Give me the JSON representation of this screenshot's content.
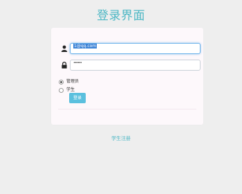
{
  "page": {
    "title": "登录界面"
  },
  "form": {
    "username": {
      "value": "1@qq.com",
      "icon": "user-icon"
    },
    "password": {
      "value": "••••••",
      "icon": "lock-icon"
    },
    "roles": [
      {
        "label": "管理员",
        "checked": true
      },
      {
        "label": "学生",
        "checked": false
      }
    ],
    "login_label": "登录"
  },
  "footer": {
    "register_label": "学生注册"
  },
  "colors": {
    "accent": "#4fb8c5",
    "button": "#5bc0de",
    "focus_border": "#66afe9"
  }
}
